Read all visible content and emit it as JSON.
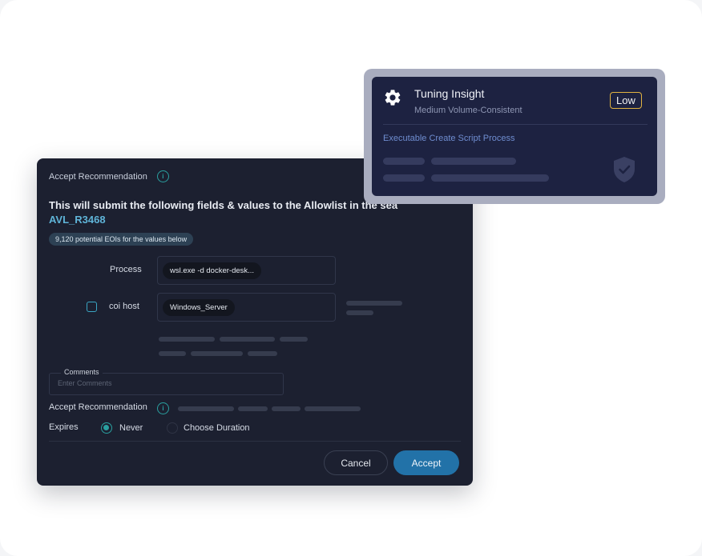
{
  "dialog": {
    "header_label": "Accept Recommendation",
    "info_glyph": "i",
    "title": "This will submit the following fields & values to the Allowlist in the sea",
    "subtitle": "AVL_R3468",
    "eoi_pill": "9,120 potential EOIs for the values below",
    "fields": [
      {
        "label": "Process",
        "value": "wsl.exe -d docker-desk..."
      },
      {
        "label": "coi host",
        "value": "Windows_Server"
      }
    ],
    "comments": {
      "legend": "Comments",
      "placeholder": "Enter Comments"
    },
    "accept_label": "Accept Recommendation",
    "expires": {
      "label": "Expires",
      "options": [
        {
          "label": "Never",
          "selected": true
        },
        {
          "label": "Choose Duration",
          "selected": false
        }
      ]
    },
    "buttons": {
      "cancel": "Cancel",
      "accept": "Accept"
    }
  },
  "insight": {
    "icon": "gear-icon",
    "title": "Tuning Insight",
    "subtitle": "Medium Volume-Consistent",
    "badge": "Low",
    "link": "Executable Create Script Process",
    "status_icon": "shield-check-icon"
  },
  "colors": {
    "dialog_bg": "#1c2030",
    "insight_bg": "#1d2241",
    "accent_teal": "#2aa0a0",
    "accent_blue": "#2272a8",
    "subtitle_blue": "#5fb4d8",
    "badge_gold": "#e1b341"
  }
}
